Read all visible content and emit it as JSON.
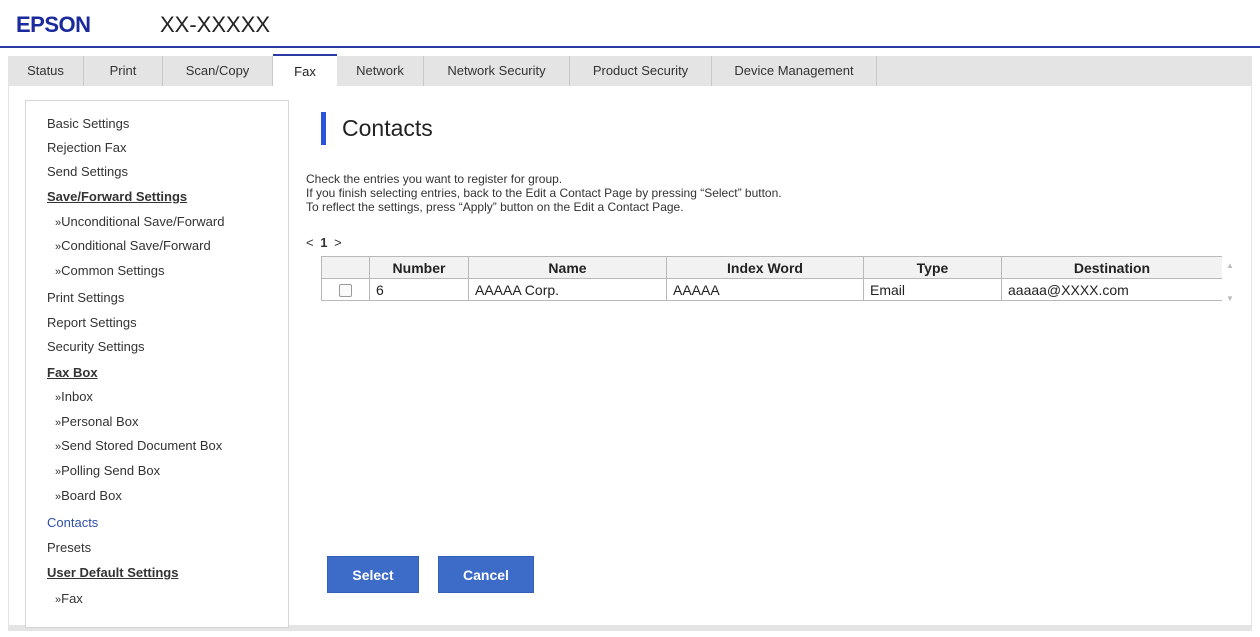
{
  "header": {
    "brand": "EPSON",
    "model": "XX-XXXXX"
  },
  "tabs": [
    {
      "label": "Status"
    },
    {
      "label": "Print"
    },
    {
      "label": "Scan/Copy"
    },
    {
      "label": "Fax",
      "active": true
    },
    {
      "label": "Network"
    },
    {
      "label": "Network Security"
    },
    {
      "label": "Product Security"
    },
    {
      "label": "Device Management"
    }
  ],
  "sidebar": {
    "items": [
      {
        "label": "Basic Settings"
      },
      {
        "label": "Rejection Fax"
      },
      {
        "label": "Send Settings"
      },
      {
        "label": "Save/Forward Settings"
      },
      {
        "label": "Unconditional Save/Forward"
      },
      {
        "label": "Conditional Save/Forward"
      },
      {
        "label": "Common Settings"
      },
      {
        "label": "Print Settings"
      },
      {
        "label": "Report Settings"
      },
      {
        "label": "Security Settings"
      },
      {
        "label": "Fax Box"
      },
      {
        "label": "Inbox"
      },
      {
        "label": "Personal Box"
      },
      {
        "label": "Send Stored Document Box"
      },
      {
        "label": "Polling Send Box"
      },
      {
        "label": "Board Box"
      },
      {
        "label": "Contacts",
        "current": true
      },
      {
        "label": "Presets"
      },
      {
        "label": "User Default Settings"
      },
      {
        "label": "Fax"
      }
    ],
    "sub_marker": "»"
  },
  "main": {
    "title": "Contacts",
    "instructions": [
      "Check the entries you want to register for group.",
      "If you finish selecting entries, back to the Edit a Contact Page by pressing “Select” button.",
      "To reflect the settings, press “Apply” button on the Edit a Contact Page."
    ],
    "pager": {
      "prev": "<",
      "page": "1",
      "next": ">"
    },
    "table": {
      "columns": [
        "",
        "Number",
        "Name",
        "Index Word",
        "Type",
        "Destination"
      ],
      "rows": [
        {
          "checked": false,
          "number": "6",
          "name": "AAAAA Corp.",
          "index_word": "AAAAA",
          "type": "Email",
          "destination": "aaaaa@XXXX.com"
        }
      ]
    },
    "buttons": {
      "select": "Select",
      "cancel": "Cancel"
    }
  },
  "colors": {
    "brand": "#1a2a9c",
    "accent": "#2a55d9",
    "button": "#3d6bc8",
    "link": "#2f50a8"
  }
}
